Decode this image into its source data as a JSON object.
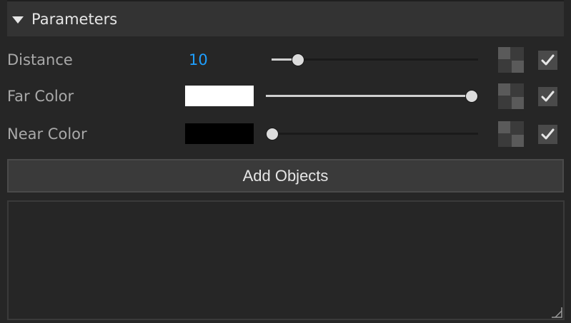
{
  "section": {
    "title": "Parameters",
    "expanded": true
  },
  "params": [
    {
      "label": "Distance",
      "type": "number",
      "value": "10",
      "slider_fraction": 0.128,
      "override_enabled": true
    },
    {
      "label": "Far Color",
      "type": "color",
      "color": "#ffffff",
      "slider_fraction": 1.0,
      "override_enabled": true
    },
    {
      "label": "Near Color",
      "type": "color",
      "color": "#000000",
      "slider_fraction": 0.0,
      "override_enabled": true
    }
  ],
  "add_objects_label": "Add Objects",
  "colors": {
    "accent_value": "#1e9fff",
    "panel_bg": "#262626",
    "header_bg": "#333333"
  },
  "icons": {
    "collapse": "triangle-down-icon",
    "override": "checker-icon",
    "check": "checkmark-icon",
    "resize": "resize-grip-icon"
  }
}
